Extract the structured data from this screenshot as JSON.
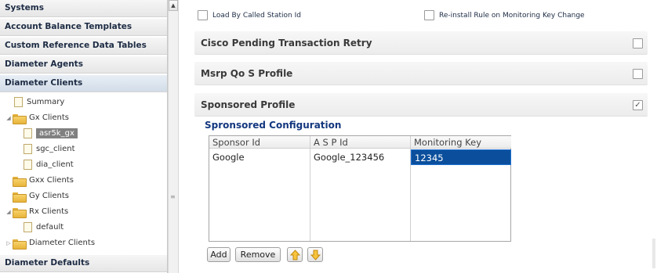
{
  "nav": {
    "top_headers": [
      "Systems",
      "Account Balance Templates",
      "Custom Reference Data Tables",
      "Diameter Agents",
      "Diameter Clients"
    ],
    "tree": {
      "summary": "Summary",
      "gx_clients": "Gx Clients",
      "asr5k_gx": "asr5k_gx",
      "sgc_client": "sgc_client",
      "dia_client": "dia_client",
      "gxx_clients": "Gxx Clients",
      "gy_clients": "Gy Clients",
      "rx_clients": "Rx Clients",
      "default": "default",
      "diameter_clients": "Diameter Clients"
    },
    "bottom_header": "Diameter Defaults"
  },
  "options": {
    "load_by_called_station": "Load By Called Station Id",
    "reinstall_rule": "Re-install Rule on Monitoring Key Change"
  },
  "sections": {
    "cisco_pending": "Cisco Pending Transaction Retry",
    "msrp_qos": "Msrp Qo S Profile",
    "sponsored_profile": "Sponsored Profile"
  },
  "config": {
    "title": "Spronsored Configuration",
    "columns": [
      "Sponsor Id",
      "A S P Id",
      "Monitoring Key"
    ],
    "row": [
      "Google",
      "Google_123456",
      "12345"
    ]
  },
  "buttons": {
    "add": "Add",
    "remove": "Remove"
  },
  "colors": {
    "selection_blue": "#0b4f9c",
    "header_text": "#13377f"
  }
}
